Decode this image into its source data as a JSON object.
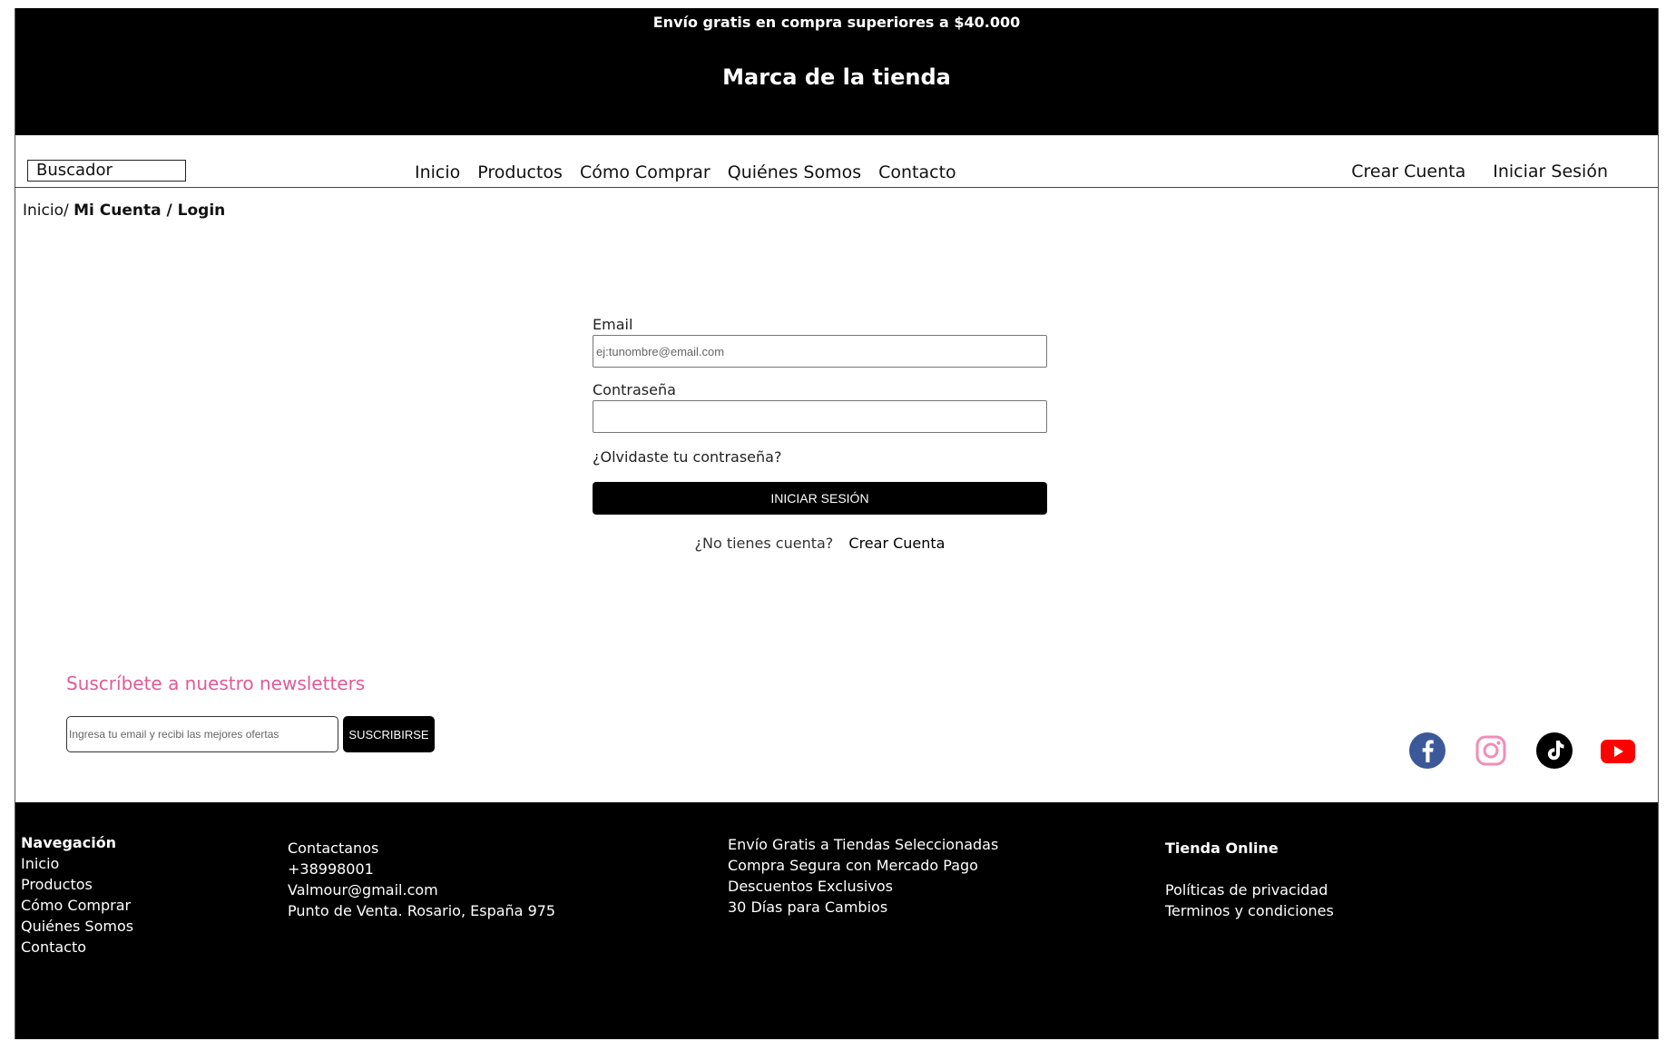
{
  "topbar": {
    "promo": "Envío gratis en compra superiores a $40.000",
    "brand": "Marca de la tienda"
  },
  "navbar": {
    "search_placeholder": "Buscador",
    "menu": [
      "Inicio",
      "Productos",
      "Cómo Comprar",
      "Quiénes Somos",
      "Contacto"
    ],
    "create_account": "Crear Cuenta",
    "login": "Iniciar Sesión"
  },
  "breadcrumb": {
    "home": "Inicio/",
    "current": "Mi Cuenta / Login"
  },
  "login_form": {
    "email_label": "Email",
    "email_placeholder": "ej:tunombre@email.com",
    "password_label": "Contraseña",
    "forgot": "¿Olvidaste tu contraseña?",
    "submit": "Iniciar sesión",
    "no_account": "¿No tienes cuenta?",
    "create_account": "Crear Cuenta"
  },
  "newsletter": {
    "title": "Suscríbete a nuestro newsletters",
    "placeholder": "Ingresa tu email y recibi las mejores ofertas",
    "button": "SUSCRIBIRSE"
  },
  "socials": [
    "facebook-icon",
    "instagram-icon",
    "tiktok-icon",
    "youtube-icon"
  ],
  "colors": {
    "newsletter_title": "#e05a98",
    "facebook": "#3b5998",
    "instagram": "#f28cb8",
    "youtube": "#ff0000"
  },
  "footer": {
    "nav": {
      "title": "Navegación",
      "items": [
        "Inicio",
        "Productos",
        "Cómo Comprar",
        "Quiénes Somos",
        "Contacto"
      ]
    },
    "contact": {
      "lines": [
        "Contactanos",
        "+38998001",
        "Valmour@gmail.com",
        "Punto de Venta. Rosario, España 975"
      ]
    },
    "benefits": {
      "lines": [
        "Envío Gratis a Tiendas Seleccionadas",
        "Compra Segura con Mercado Pago",
        "Descuentos Exclusivos",
        "30 Días para Cambios"
      ]
    },
    "store": {
      "title": "Tienda Online",
      "links": [
        "Políticas de privacidad",
        "Terminos y condiciones"
      ]
    }
  }
}
